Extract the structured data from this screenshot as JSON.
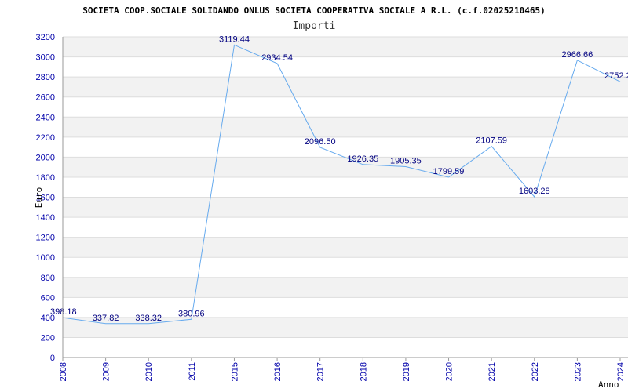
{
  "chart_data": {
    "type": "line",
    "title": "SOCIETA COOP.SOCIALE SOLIDANDO ONLUS SOCIETA COOPERATIVA SOCIALE A R.L. (c.f.02025210465)",
    "subtitle": "Importi",
    "xlabel": "Anno",
    "ylabel": "Euro",
    "ylim": [
      0,
      3200
    ],
    "ytick_step": 200,
    "grid": true,
    "categories": [
      "2008",
      "2009",
      "2010",
      "2011",
      "2015",
      "2016",
      "2017",
      "2018",
      "2019",
      "2020",
      "2021",
      "2022",
      "2023",
      "2024"
    ],
    "series": [
      {
        "values": [
          398.18,
          337.82,
          338.32,
          380.96,
          3119.44,
          2934.54,
          2096.5,
          1926.35,
          1905.35,
          1799.59,
          2107.59,
          1603.28,
          2966.66,
          2752.2
        ],
        "value_labels": [
          "398.18",
          "337.82",
          "338.32",
          "380.96",
          "3119.44",
          "2934.54",
          "2096.50",
          "1926.35",
          "1905.35",
          "1799.59",
          "2107.59",
          "1603.28",
          "2966.66",
          "2752.2"
        ]
      }
    ],
    "colors": {
      "line": "#66aaee",
      "band": "#f2f2f2",
      "grid": "#dddddd",
      "tick": "#0000aa",
      "data_label": "#000080"
    }
  }
}
